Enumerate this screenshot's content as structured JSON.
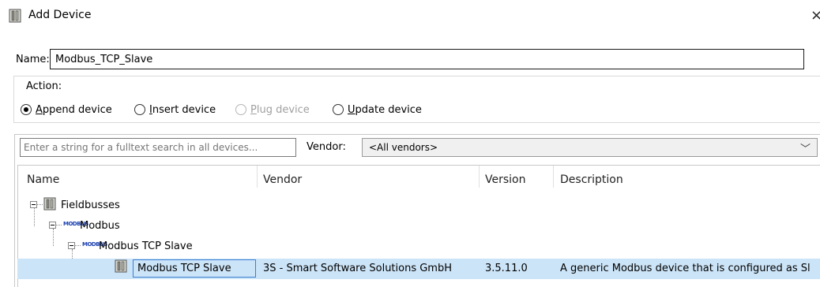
{
  "window": {
    "title": "Add Device",
    "close_glyph": "×"
  },
  "name_field": {
    "label": "Name:",
    "value": "Modbus_TCP_Slave"
  },
  "action": {
    "legend": "Action:",
    "options": [
      {
        "label": "Append device",
        "accel": "A",
        "rest": "ppend device",
        "checked": true,
        "enabled": true
      },
      {
        "label": "Insert device",
        "accel": "I",
        "rest": "nsert device",
        "checked": false,
        "enabled": true
      },
      {
        "label": "Plug device",
        "accel": "P",
        "rest": "lug device",
        "checked": false,
        "enabled": false
      },
      {
        "label": "Update device",
        "accel": "U",
        "rest": "pdate device",
        "checked": false,
        "enabled": true
      }
    ]
  },
  "search": {
    "placeholder": "Enter a string for a fulltext search in all devices...",
    "vendor_label": "Vendor:",
    "vendor_value": "<All vendors>",
    "vendor_chevron": "﹀"
  },
  "table": {
    "columns": [
      "Name",
      "Vendor",
      "Version",
      "Description"
    ],
    "tree": [
      {
        "label": "Fieldbusses",
        "icon": "fieldbus-icon"
      },
      {
        "label": "Modbus",
        "icon": "modbus-icon",
        "icon_text": "MODBUS"
      },
      {
        "label": "Modbus TCP Slave",
        "icon": "modbus-icon",
        "icon_text": "MODBUS"
      },
      {
        "label": "Modbus TCP Slave",
        "icon": "device-icon",
        "vendor": "3S - Smart Software Solutions GmbH",
        "version": "3.5.11.0",
        "description": "A generic Modbus device that is configured as Sl",
        "selected": true
      }
    ]
  },
  "colors": {
    "selection": "#cce4f7",
    "focus_border": "#3b7fd1",
    "modbus_blue": "#1a3fb0"
  }
}
